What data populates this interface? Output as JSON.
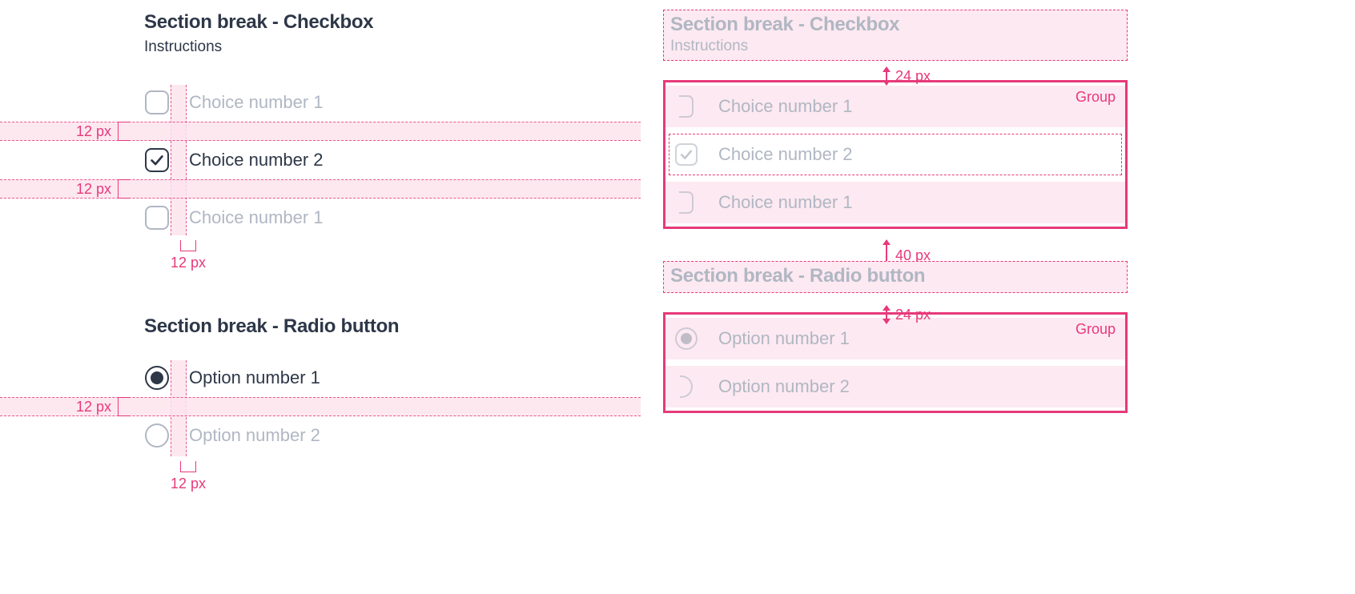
{
  "spacing": {
    "horizontal_gap_label": "12 px",
    "vertical_row_gap_label": "12 px",
    "header_to_group_label": "24 px",
    "group_to_next_section_label": "40 px"
  },
  "left": {
    "checkbox_section": {
      "title": "Section break - Checkbox",
      "instructions": "Instructions",
      "options": [
        {
          "label": "Choice number 1",
          "checked": false
        },
        {
          "label": "Choice number 2",
          "checked": true
        },
        {
          "label": "Choice number 1",
          "checked": false
        }
      ]
    },
    "radio_section": {
      "title": "Section break - Radio button",
      "options": [
        {
          "label": "Option number 1",
          "checked": true
        },
        {
          "label": "Option number 2",
          "checked": false
        }
      ]
    }
  },
  "right": {
    "group_tag": "Group",
    "checkbox_section": {
      "title": "Section break - Checkbox",
      "instructions": "Instructions",
      "options": [
        {
          "label": "Choice number 1",
          "checked": false
        },
        {
          "label": "Choice number 2",
          "checked": true
        },
        {
          "label": "Choice number 1",
          "checked": false
        }
      ]
    },
    "radio_section": {
      "title": "Section break - Radio button",
      "options": [
        {
          "label": "Option number 1",
          "checked": true
        },
        {
          "label": "Option number 2",
          "checked": false
        }
      ]
    }
  }
}
